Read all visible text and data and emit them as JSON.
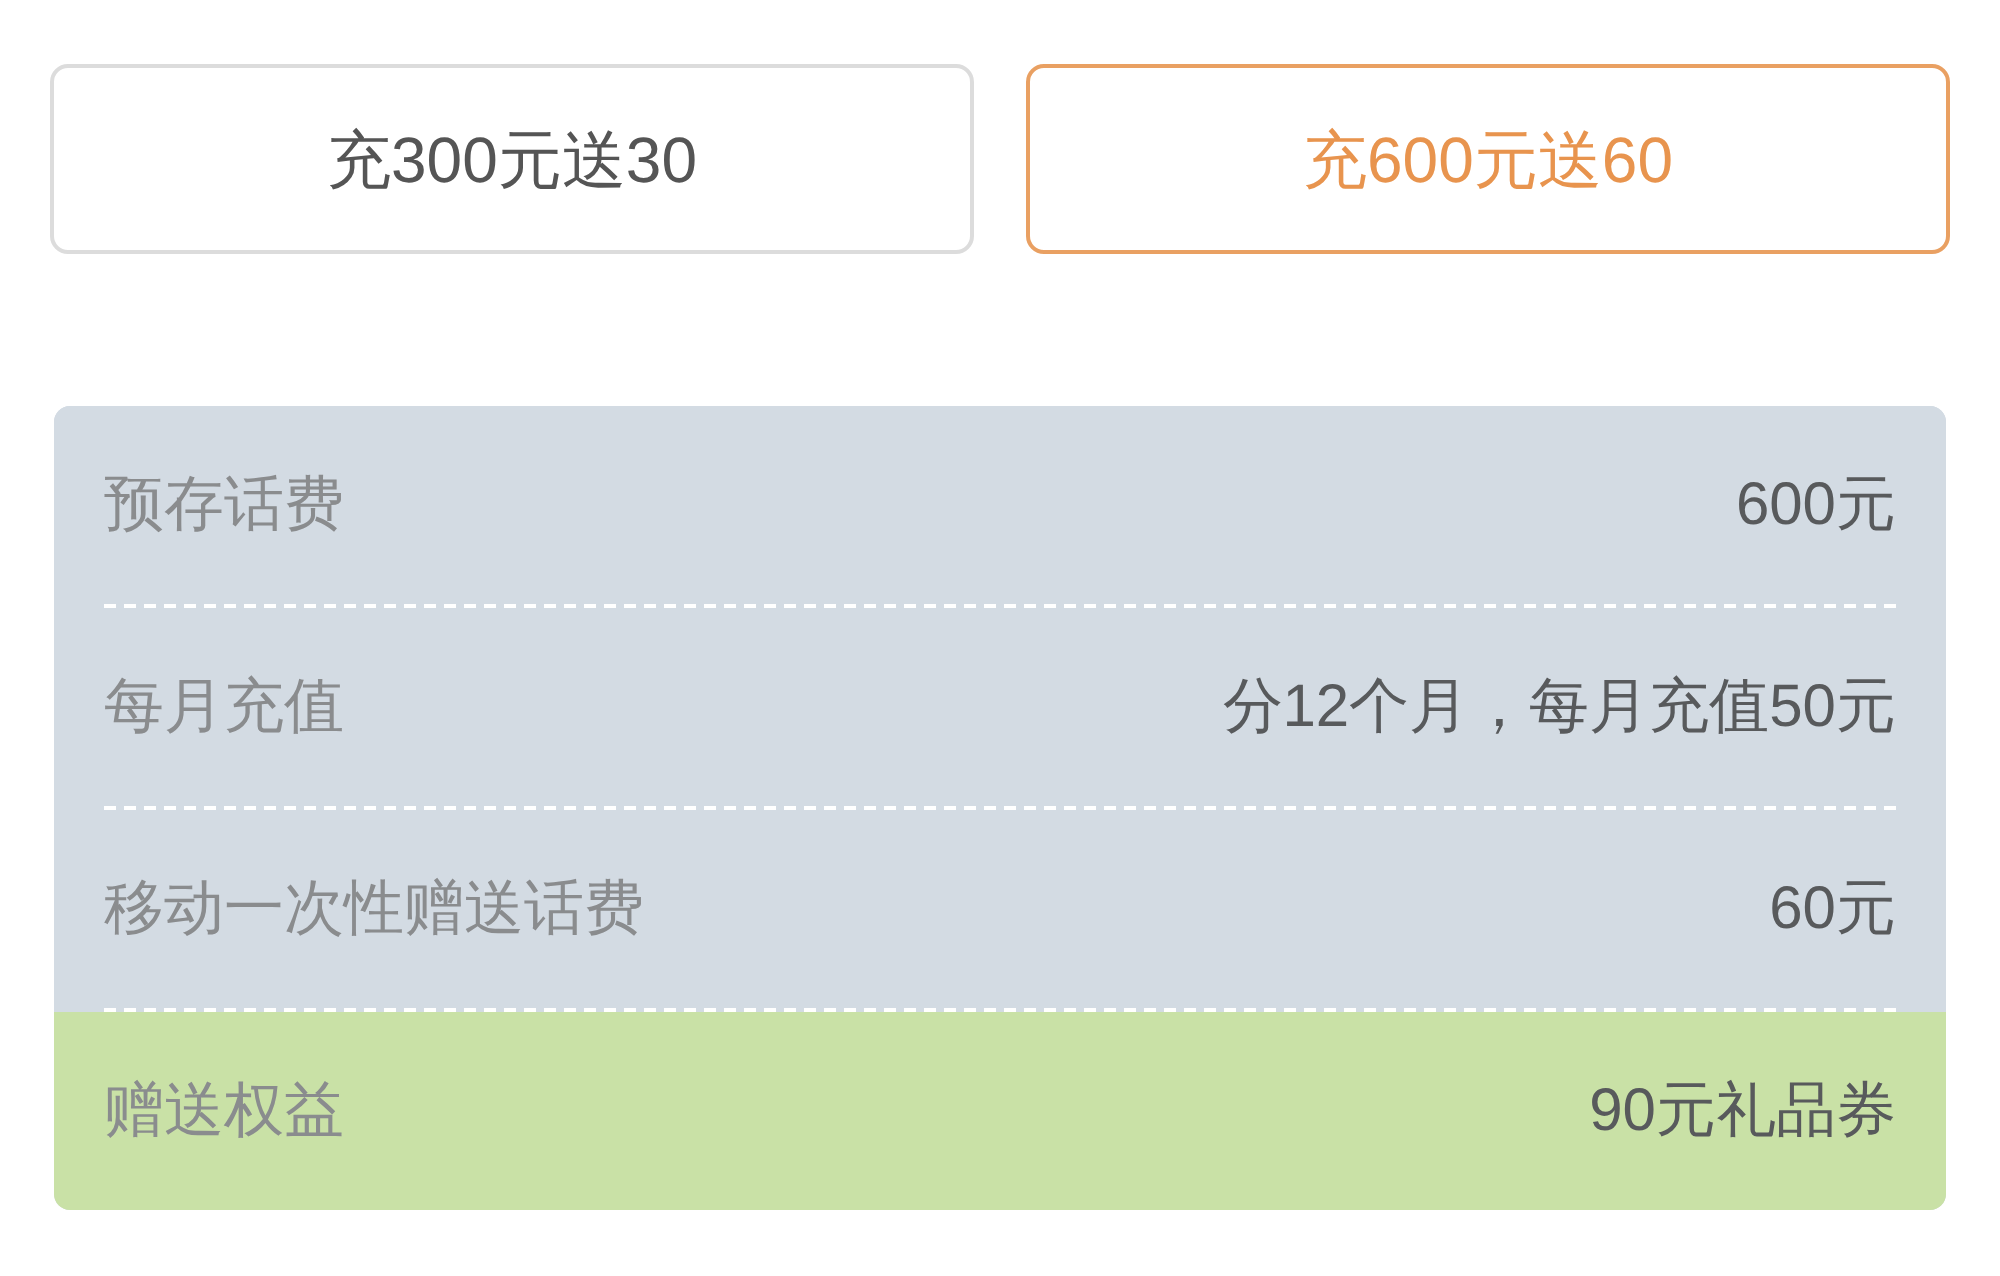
{
  "options": [
    {
      "label": "充300元送30",
      "selected": false
    },
    {
      "label": "充600元送60",
      "selected": true
    }
  ],
  "details": [
    {
      "label": "预存话费",
      "value": "600元",
      "highlighted": false
    },
    {
      "label": "每月充值",
      "value": "分12个月，每月充值50元",
      "highlighted": false
    },
    {
      "label": "移动一次性赠送话费",
      "value": "60元",
      "highlighted": false
    },
    {
      "label": "赠送权益",
      "value": "90元礼品券",
      "highlighted": true
    }
  ]
}
